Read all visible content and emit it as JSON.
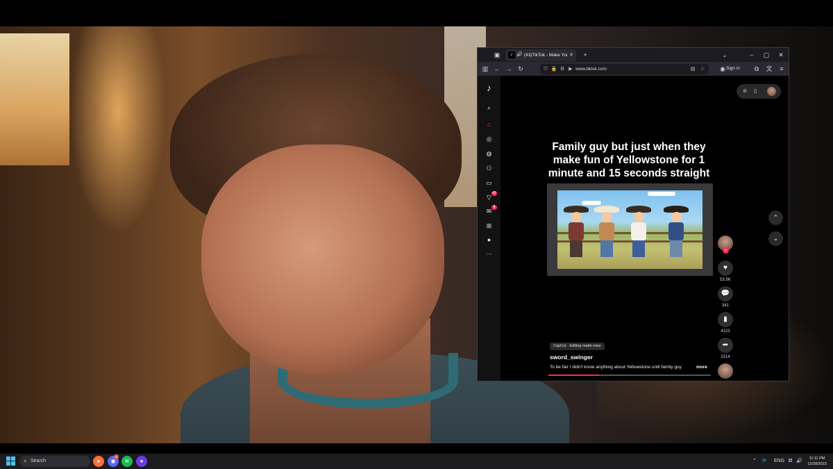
{
  "taskbar": {
    "search_placeholder": "Search",
    "apps": [
      {
        "name": "firefox-icon",
        "glyph": "🦊",
        "color": "#ff7139"
      },
      {
        "name": "discord-icon",
        "glyph": "◉",
        "color": "#5865f2"
      },
      {
        "name": "spotify-icon",
        "glyph": "≋",
        "color": "#1db954"
      },
      {
        "name": "app-icon",
        "glyph": "●",
        "color": "#6a3ee3"
      }
    ],
    "discord_badge": "8",
    "tray": {
      "lang": "ENG",
      "time": "11:11 PM",
      "date": "12/28/2023"
    }
  },
  "browser": {
    "tab": {
      "title": "(43)TikTok - Make Your Day",
      "close": "✕"
    },
    "new_tab": "+",
    "url": "www.tiktok.com",
    "sign_in": "Sign in"
  },
  "tiktok": {
    "sidenav_badges": {
      "activity": "42",
      "messages": "8"
    },
    "caption": "Family guy but just when they make fun of Yellowstone for 1 minute and 15 seconds straight",
    "likes": "53.5K",
    "comments": "341",
    "saves": "4123",
    "shares": "2214",
    "capcut": "CapCut · Editing made easy",
    "username": "sword_swinger",
    "description": "To be fair I didn't know anything about Yellowstone until family guy",
    "more": "more",
    "progress": 0.31,
    "accent": "#fe2c55"
  }
}
